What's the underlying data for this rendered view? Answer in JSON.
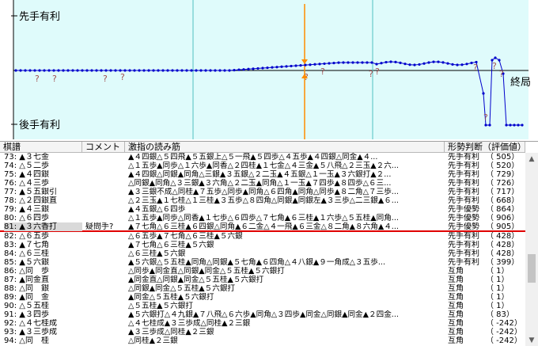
{
  "graph": {
    "top_label": "先手有利",
    "bottom_label": "後手有利",
    "end_label": "終局",
    "question_mark": "?",
    "colors": {
      "plot_bg": "#dffbfb",
      "line": "#0000cc",
      "marker": "#ff8c00",
      "divider": "#52c0c0",
      "question": "#a05050"
    }
  },
  "table": {
    "headers": {
      "kifu": "棋譜",
      "comment": "コメント",
      "pv": "激指の読み筋",
      "judge": "形勢判断（評価値）"
    },
    "selected_index": 8,
    "rows": [
      {
        "move": "73: ▲３七金",
        "comment": "",
        "pv": "▲４四銀△５四飛▲５五銀上△５一飛▲５四歩△４五歩▲４四銀△同金▲４...",
        "judge": "先手有利",
        "value": "（ 505）"
      },
      {
        "move": "74: △５二歩",
        "comment": "",
        "pv": "△１五歩▲同歩△１六歩▲同香△２四桂▲１七金△４三金▲５八飛△２三玉▲２六...",
        "judge": "先手有利",
        "value": "（ 520）"
      },
      {
        "move": "75: ▲４四銀",
        "comment": "",
        "pv": "▲４四銀△同銀▲同角△三銀▲３五銀△２二玉▲４五銀△１一玉▲３六銀打▲２...",
        "judge": "先手有利",
        "value": "（ 729）"
      },
      {
        "move": "76: △４三歩",
        "comment": "",
        "pv": "△同銀▲同角△３三銀▲３六角△２二玉▲同角△１一玉▲７四歩▲８四歩△６三...",
        "judge": "先手有利",
        "value": "（ 726）"
      },
      {
        "move": "77: ▲５五銀引",
        "comment": "",
        "pv": "▲３三銀不成△同桂▲７五歩△同歩▲同角△６四角▲同角△同歩▲８二角△７三歩...",
        "judge": "先手有利",
        "value": "（ 717）"
      },
      {
        "move": "78: △２四銀直",
        "comment": "",
        "pv": "△２三玉▲１七桂△１三桂▲３五歩△８四角△同銀▲同銀左▲３三歩△二三銀▲６...",
        "judge": "先手有利",
        "value": "（ 668）"
      },
      {
        "move": "79: ▲４三銀",
        "comment": "",
        "pv": "▲４五銀△６四歩",
        "judge": "先手優勢",
        "value": "（ 864）"
      },
      {
        "move": "80: △６四歩",
        "comment": "",
        "pv": "△１五歩▲同歩△同香▲１七歩△６四歩△７七角▲６三桂▲１六歩△５五桂▲同角...",
        "judge": "先手優勢",
        "value": "（ 906）"
      },
      {
        "move": "81: ▲３六香打",
        "comment": "疑問手?",
        "pv": "▲７七角△６三桂▲６四銀△同角▲６二金△４一飛▲６三金△８二角▲８六角▲４...",
        "judge": "先手優勢",
        "value": "（ 905）"
      },
      {
        "move": "82: △６五歩",
        "comment": "",
        "pv": "△６五歩▲７七角△６三桂▲５六銀",
        "judge": "先手有利",
        "value": "（ 428）"
      },
      {
        "move": "83: ▲７七角",
        "comment": "",
        "pv": "▲７七角△６三桂▲５六銀",
        "judge": "先手有利",
        "value": "（ 428）"
      },
      {
        "move": "84: △６三桂",
        "comment": "",
        "pv": "△６三桂▲５六銀",
        "judge": "先手有利",
        "value": "（ 428）"
      },
      {
        "move": "85: ▲５六銀",
        "comment": "",
        "pv": "▲５六銀△５五桂▲同角△同銀▲５七角▲６四角△４八銀▲９一角成△３五歩...",
        "judge": "先手有利",
        "value": "（ 399）"
      },
      {
        "move": "86: △同　歩",
        "comment": "",
        "pv": "△同歩▲同金直△同銀▲同金△５五桂▲５六銀打",
        "judge": "互角",
        "value": "（ 1）"
      },
      {
        "move": "87: ▲同金直",
        "comment": "",
        "pv": "▲同金直△同銀▲同金△５五桂▲５六銀打",
        "judge": "互角",
        "value": "（ 1）"
      },
      {
        "move": "88: △同　銀",
        "comment": "",
        "pv": "△同銀▲同金△５五桂▲５六銀打",
        "judge": "互角",
        "value": "（ 1）"
      },
      {
        "move": "89: ▲同　金",
        "comment": "",
        "pv": "▲同金△５五桂▲５六銀打",
        "judge": "互角",
        "value": "（ 1）"
      },
      {
        "move": "90: △５五桂",
        "comment": "",
        "pv": "△５五桂▲５六銀打",
        "judge": "互角",
        "value": "（ 1）"
      },
      {
        "move": "91: ▲３四歩",
        "comment": "",
        "pv": "▲５六銀打△４九銀▲７八飛△６六歩▲同角△３四歩▲同金△同銀▲同金▲２四金...",
        "judge": "互角",
        "value": "（ 83）"
      },
      {
        "move": "92: △４七桂成",
        "comment": "",
        "pv": "△４七桂成▲３三歩成△同桂▲２三銀",
        "judge": "互角",
        "value": "（ -242）"
      },
      {
        "move": "93: ▲３三歩成",
        "comment": "",
        "pv": "▲３三歩成△同桂▲２三銀",
        "judge": "互角",
        "value": "（ -242）"
      },
      {
        "move": "94: △同　桂",
        "comment": "",
        "pv": "△同桂▲２三銀",
        "judge": "互角",
        "value": "（ -242）"
      }
    ]
  },
  "scrollbar": {
    "up": "▲",
    "down": "▼"
  }
}
